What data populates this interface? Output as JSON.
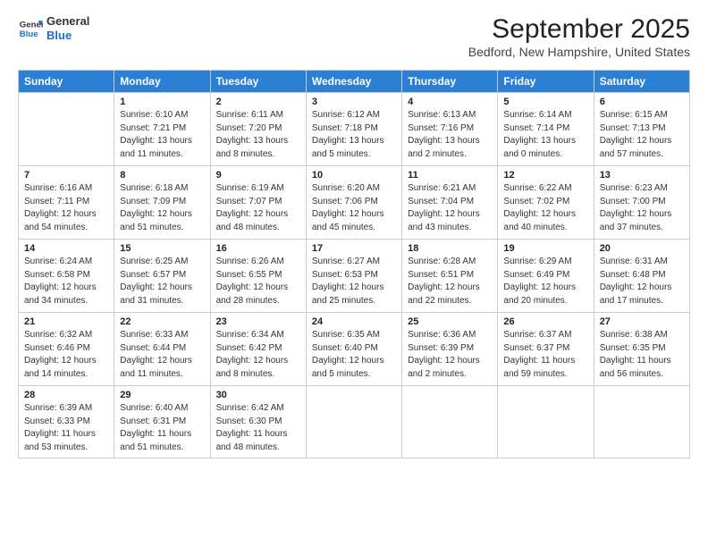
{
  "header": {
    "logo_line1": "General",
    "logo_line2": "Blue",
    "month_title": "September 2025",
    "location": "Bedford, New Hampshire, United States"
  },
  "days_of_week": [
    "Sunday",
    "Monday",
    "Tuesday",
    "Wednesday",
    "Thursday",
    "Friday",
    "Saturday"
  ],
  "weeks": [
    [
      {
        "day": "",
        "sunrise": "",
        "sunset": "",
        "daylight": ""
      },
      {
        "day": "1",
        "sunrise": "Sunrise: 6:10 AM",
        "sunset": "Sunset: 7:21 PM",
        "daylight": "Daylight: 13 hours and 11 minutes."
      },
      {
        "day": "2",
        "sunrise": "Sunrise: 6:11 AM",
        "sunset": "Sunset: 7:20 PM",
        "daylight": "Daylight: 13 hours and 8 minutes."
      },
      {
        "day": "3",
        "sunrise": "Sunrise: 6:12 AM",
        "sunset": "Sunset: 7:18 PM",
        "daylight": "Daylight: 13 hours and 5 minutes."
      },
      {
        "day": "4",
        "sunrise": "Sunrise: 6:13 AM",
        "sunset": "Sunset: 7:16 PM",
        "daylight": "Daylight: 13 hours and 2 minutes."
      },
      {
        "day": "5",
        "sunrise": "Sunrise: 6:14 AM",
        "sunset": "Sunset: 7:14 PM",
        "daylight": "Daylight: 13 hours and 0 minutes."
      },
      {
        "day": "6",
        "sunrise": "Sunrise: 6:15 AM",
        "sunset": "Sunset: 7:13 PM",
        "daylight": "Daylight: 12 hours and 57 minutes."
      }
    ],
    [
      {
        "day": "7",
        "sunrise": "Sunrise: 6:16 AM",
        "sunset": "Sunset: 7:11 PM",
        "daylight": "Daylight: 12 hours and 54 minutes."
      },
      {
        "day": "8",
        "sunrise": "Sunrise: 6:18 AM",
        "sunset": "Sunset: 7:09 PM",
        "daylight": "Daylight: 12 hours and 51 minutes."
      },
      {
        "day": "9",
        "sunrise": "Sunrise: 6:19 AM",
        "sunset": "Sunset: 7:07 PM",
        "daylight": "Daylight: 12 hours and 48 minutes."
      },
      {
        "day": "10",
        "sunrise": "Sunrise: 6:20 AM",
        "sunset": "Sunset: 7:06 PM",
        "daylight": "Daylight: 12 hours and 45 minutes."
      },
      {
        "day": "11",
        "sunrise": "Sunrise: 6:21 AM",
        "sunset": "Sunset: 7:04 PM",
        "daylight": "Daylight: 12 hours and 43 minutes."
      },
      {
        "day": "12",
        "sunrise": "Sunrise: 6:22 AM",
        "sunset": "Sunset: 7:02 PM",
        "daylight": "Daylight: 12 hours and 40 minutes."
      },
      {
        "day": "13",
        "sunrise": "Sunrise: 6:23 AM",
        "sunset": "Sunset: 7:00 PM",
        "daylight": "Daylight: 12 hours and 37 minutes."
      }
    ],
    [
      {
        "day": "14",
        "sunrise": "Sunrise: 6:24 AM",
        "sunset": "Sunset: 6:58 PM",
        "daylight": "Daylight: 12 hours and 34 minutes."
      },
      {
        "day": "15",
        "sunrise": "Sunrise: 6:25 AM",
        "sunset": "Sunset: 6:57 PM",
        "daylight": "Daylight: 12 hours and 31 minutes."
      },
      {
        "day": "16",
        "sunrise": "Sunrise: 6:26 AM",
        "sunset": "Sunset: 6:55 PM",
        "daylight": "Daylight: 12 hours and 28 minutes."
      },
      {
        "day": "17",
        "sunrise": "Sunrise: 6:27 AM",
        "sunset": "Sunset: 6:53 PM",
        "daylight": "Daylight: 12 hours and 25 minutes."
      },
      {
        "day": "18",
        "sunrise": "Sunrise: 6:28 AM",
        "sunset": "Sunset: 6:51 PM",
        "daylight": "Daylight: 12 hours and 22 minutes."
      },
      {
        "day": "19",
        "sunrise": "Sunrise: 6:29 AM",
        "sunset": "Sunset: 6:49 PM",
        "daylight": "Daylight: 12 hours and 20 minutes."
      },
      {
        "day": "20",
        "sunrise": "Sunrise: 6:31 AM",
        "sunset": "Sunset: 6:48 PM",
        "daylight": "Daylight: 12 hours and 17 minutes."
      }
    ],
    [
      {
        "day": "21",
        "sunrise": "Sunrise: 6:32 AM",
        "sunset": "Sunset: 6:46 PM",
        "daylight": "Daylight: 12 hours and 14 minutes."
      },
      {
        "day": "22",
        "sunrise": "Sunrise: 6:33 AM",
        "sunset": "Sunset: 6:44 PM",
        "daylight": "Daylight: 12 hours and 11 minutes."
      },
      {
        "day": "23",
        "sunrise": "Sunrise: 6:34 AM",
        "sunset": "Sunset: 6:42 PM",
        "daylight": "Daylight: 12 hours and 8 minutes."
      },
      {
        "day": "24",
        "sunrise": "Sunrise: 6:35 AM",
        "sunset": "Sunset: 6:40 PM",
        "daylight": "Daylight: 12 hours and 5 minutes."
      },
      {
        "day": "25",
        "sunrise": "Sunrise: 6:36 AM",
        "sunset": "Sunset: 6:39 PM",
        "daylight": "Daylight: 12 hours and 2 minutes."
      },
      {
        "day": "26",
        "sunrise": "Sunrise: 6:37 AM",
        "sunset": "Sunset: 6:37 PM",
        "daylight": "Daylight: 11 hours and 59 minutes."
      },
      {
        "day": "27",
        "sunrise": "Sunrise: 6:38 AM",
        "sunset": "Sunset: 6:35 PM",
        "daylight": "Daylight: 11 hours and 56 minutes."
      }
    ],
    [
      {
        "day": "28",
        "sunrise": "Sunrise: 6:39 AM",
        "sunset": "Sunset: 6:33 PM",
        "daylight": "Daylight: 11 hours and 53 minutes."
      },
      {
        "day": "29",
        "sunrise": "Sunrise: 6:40 AM",
        "sunset": "Sunset: 6:31 PM",
        "daylight": "Daylight: 11 hours and 51 minutes."
      },
      {
        "day": "30",
        "sunrise": "Sunrise: 6:42 AM",
        "sunset": "Sunset: 6:30 PM",
        "daylight": "Daylight: 11 hours and 48 minutes."
      },
      {
        "day": "",
        "sunrise": "",
        "sunset": "",
        "daylight": ""
      },
      {
        "day": "",
        "sunrise": "",
        "sunset": "",
        "daylight": ""
      },
      {
        "day": "",
        "sunrise": "",
        "sunset": "",
        "daylight": ""
      },
      {
        "day": "",
        "sunrise": "",
        "sunset": "",
        "daylight": ""
      }
    ]
  ]
}
